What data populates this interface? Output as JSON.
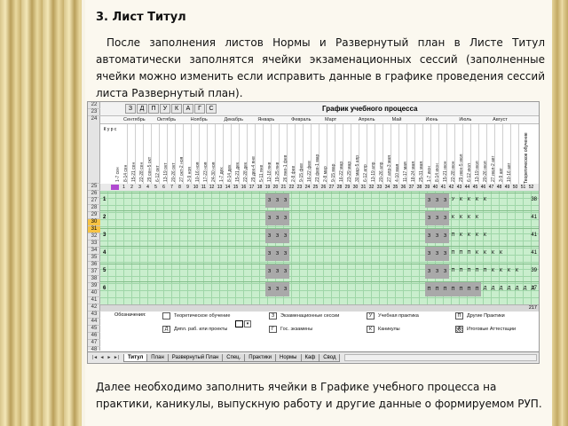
{
  "heading": "3. Лист Титул",
  "intro": "После заполнения листов Нормы и Развернутый план в Листе Титул автоматически заполнятся ячейки экзаменационных сессий (заполненные ячейки можно изменить если исправить данные в графике проведения сессий листа Развернутый план).",
  "outro": "Далее необходимо заполнить ячейки в Графике учебного процесса на практики, каникулы, выпускную работу и другие данные о формируемом РУП.",
  "sheet": {
    "zdp_letters": [
      "З",
      "Д",
      "П",
      "У",
      "К",
      "А",
      "Г",
      "С"
    ],
    "schedule_title": "График учебного процесса",
    "kurs_label": "К у р с",
    "total_label": "Теоретическое обучение",
    "row_numbers": [
      "22",
      "23",
      "24",
      "25",
      "26",
      "27",
      "28",
      "29",
      "30",
      "31",
      "32",
      "33",
      "34",
      "35",
      "36",
      "37",
      "38",
      "39",
      "40",
      "41",
      "42",
      "43",
      "44",
      "45",
      "46",
      "47",
      "48",
      "49"
    ],
    "selected_rows": [
      "30",
      "31"
    ],
    "months": [
      "Сентябрь",
      "Октябрь",
      "Ноябрь",
      "Декабрь",
      "Январь",
      "Февраль",
      "Март",
      "Апрель",
      "Май",
      "Июнь",
      "Июль",
      "Август"
    ],
    "week_labels": [
      "1-7 сен",
      "8-14 сен",
      "15-21 сен",
      "22-28 сен",
      "29 сен-5 окт",
      "6-12 окт",
      "13-19 окт",
      "20-26 окт",
      "27 окт-2 ноя",
      "3-9 ноя",
      "10-16 ноя",
      "17-23 ноя",
      "24-30 ноя",
      "1-7 дек",
      "8-14 дек",
      "15-21 дек",
      "22-28 дек",
      "29 дек-4 янв",
      "5-11 янв",
      "12-18 янв",
      "19-25 янв",
      "26 янв-1 фев",
      "2-8 фев",
      "9-15 фев",
      "16-22 фев",
      "23 фев-1 мар",
      "2-8 мар",
      "9-15 мар",
      "16-22 мар",
      "23-29 мар",
      "30 мар-5 апр",
      "6-12 апр",
      "13-19 апр",
      "20-26 апр",
      "27 апр-3 мая",
      "4-10 мая",
      "11-17 мая",
      "18-24 мая",
      "25-31 мая",
      "1-7 июн",
      "8-14 июн",
      "15-21 июн",
      "22-28 июн",
      "29 июн-5 июл",
      "6-12 июл",
      "13-19 июл",
      "20-26 июл",
      "27 июл-2 авг",
      "3-9 авг",
      "10-16 авг"
    ],
    "week_numbers": [
      "1",
      "2",
      "3",
      "4",
      "5",
      "6",
      "7",
      "8",
      "9",
      "10",
      "11",
      "12",
      "13",
      "14",
      "15",
      "16",
      "17",
      "18",
      "19",
      "20",
      "21",
      "22",
      "23",
      "24",
      "25",
      "26",
      "27",
      "28",
      "29",
      "30",
      "31",
      "32",
      "33",
      "34",
      "35",
      "36",
      "37",
      "38",
      "39",
      "40",
      "41",
      "42",
      "43",
      "44",
      "45",
      "46",
      "47",
      "48",
      "49",
      "50",
      "51",
      "52"
    ],
    "courses": [
      {
        "num": "1",
        "session_a": [
          "З",
          "З",
          "З"
        ],
        "session_b": [
          "З",
          "З",
          "З"
        ],
        "tail": [
          "У",
          "К",
          "К",
          "К",
          "К"
        ],
        "total": "38"
      },
      {
        "num": "2",
        "session_a": [
          "З",
          "З",
          "З"
        ],
        "session_b": [
          "З",
          "З",
          "З"
        ],
        "tail": [
          "К",
          "К",
          "К",
          "К"
        ],
        "total": "41"
      },
      {
        "num": "3",
        "session_a": [
          "З",
          "З",
          "З"
        ],
        "session_b": [
          "З",
          "З",
          "З"
        ],
        "tail": [
          "П",
          "К",
          "К",
          "К",
          "К"
        ],
        "total": "41"
      },
      {
        "num": "4",
        "session_a": [
          "З",
          "З",
          "З"
        ],
        "session_b": [
          "З",
          "З",
          "З"
        ],
        "tail": [
          "П",
          "П",
          "П",
          "К",
          "К",
          "К",
          "К"
        ],
        "total": "41"
      },
      {
        "num": "5",
        "session_a": [
          "З",
          "З",
          "З"
        ],
        "session_b": [
          "З",
          "З",
          "З"
        ],
        "tail": [
          "П",
          "П",
          "П",
          "П",
          "П",
          "К",
          "К",
          "К",
          "К"
        ],
        "total": "39"
      },
      {
        "num": "6",
        "session_a": [
          "З",
          "З",
          "З"
        ],
        "session_b": [
          "П",
          "П",
          "П",
          "П",
          "П",
          "П",
          "П"
        ],
        "tail": [
          "Д",
          "Д",
          "Д",
          "Д",
          "Д",
          "Д",
          "Д",
          "Д",
          "Д"
        ],
        "total": "17"
      }
    ],
    "grand_total": "217",
    "legend_caption": "Обозначения:",
    "legend": [
      {
        "symbol": "",
        "text": "Теоретическое обучение"
      },
      {
        "symbol": "З",
        "text": "Экзаменационные сессии"
      },
      {
        "symbol": "У",
        "text": "Учебная практика"
      },
      {
        "symbol": "П",
        "text": "Другие Практики"
      },
      {
        "symbol": "Д",
        "text": "Дипл. раб. или проекты"
      },
      {
        "symbol": "Г",
        "text": "Гос. экзамены"
      },
      {
        "symbol": "К",
        "text": "Каникулы"
      },
      {
        "symbol": "А",
        "text": "Итоговые Аттестации"
      }
    ],
    "tabs": [
      "Титул",
      "План",
      "Развернутый План",
      "Спец.",
      "Практики",
      "Нормы",
      "Каф",
      "Свод"
    ],
    "active_tab": "Титул",
    "nav_arrows": [
      "|◄",
      "◄",
      "►",
      "►|"
    ]
  }
}
